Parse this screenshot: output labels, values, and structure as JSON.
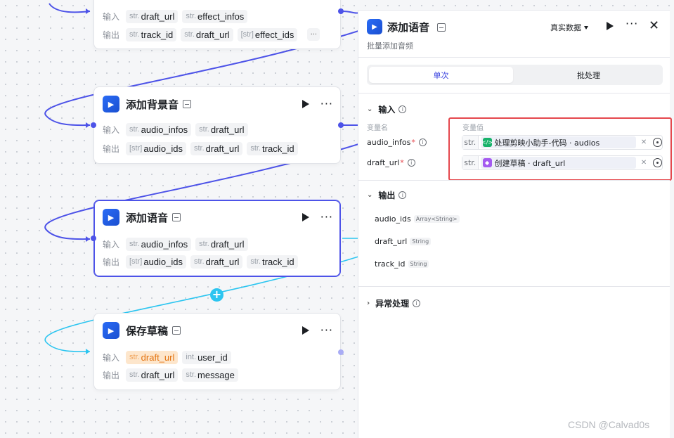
{
  "canvas": {
    "nodes": [
      {
        "title": "",
        "input_label": "输入",
        "output_label": "输出",
        "inputs": [
          {
            "type": "str.",
            "name": "draft_url"
          },
          {
            "type": "str.",
            "name": "effect_infos"
          }
        ],
        "outputs": [
          {
            "type": "str.",
            "name": "track_id"
          },
          {
            "type": "str.",
            "name": "draft_url"
          },
          {
            "type": "[str]",
            "name": "effect_ids"
          }
        ],
        "more_label": "···"
      },
      {
        "title": "添加背景音",
        "input_label": "输入",
        "output_label": "输出",
        "inputs": [
          {
            "type": "str.",
            "name": "audio_infos"
          },
          {
            "type": "str.",
            "name": "draft_url"
          }
        ],
        "outputs": [
          {
            "type": "[str]",
            "name": "audio_ids"
          },
          {
            "type": "str.",
            "name": "draft_url"
          },
          {
            "type": "str.",
            "name": "track_id"
          }
        ]
      },
      {
        "title": "添加语音",
        "input_label": "输入",
        "output_label": "输出",
        "inputs": [
          {
            "type": "str.",
            "name": "audio_infos"
          },
          {
            "type": "str.",
            "name": "draft_url"
          }
        ],
        "outputs": [
          {
            "type": "[str]",
            "name": "audio_ids"
          },
          {
            "type": "str.",
            "name": "draft_url"
          },
          {
            "type": "str.",
            "name": "track_id"
          }
        ]
      },
      {
        "title": "保存草稿",
        "input_label": "输入",
        "output_label": "输出",
        "inputs": [
          {
            "type": "str.",
            "name": "draft_url"
          },
          {
            "type": "int.",
            "name": "user_id"
          }
        ],
        "outputs": [
          {
            "type": "str.",
            "name": "draft_url"
          },
          {
            "type": "str.",
            "name": "message"
          }
        ]
      }
    ],
    "add_node_label": "+"
  },
  "panel": {
    "title": "添加语音",
    "subtitle": "批量添加音频",
    "data_select": "真实数据",
    "tabs": {
      "single": "单次",
      "batch": "批处理"
    },
    "input_section": {
      "title": "输入",
      "col_name": "变量名",
      "col_value": "变量值",
      "params": [
        {
          "name": "audio_infos",
          "required": "*",
          "type": "str.",
          "ref_icon": "code-icon",
          "ref": "处理剪映小助手-代码 · audios"
        },
        {
          "name": "draft_url",
          "required": "*",
          "type": "str.",
          "ref_icon": "cube-icon",
          "ref": "创建草稿 · draft_url"
        }
      ]
    },
    "output_section": {
      "title": "输出",
      "items": [
        {
          "name": "audio_ids",
          "type": "Array<String>"
        },
        {
          "name": "draft_url",
          "type": "String"
        },
        {
          "name": "track_id",
          "type": "String"
        }
      ]
    },
    "error_section": {
      "title": "异常处理"
    }
  },
  "watermark": "CSDN @Calvad0s",
  "colors": {
    "accent": "#4d53e8",
    "highlight": "#e5484d",
    "wire_dark": "#4d53e8",
    "wire_light": "#2cc5f0"
  }
}
